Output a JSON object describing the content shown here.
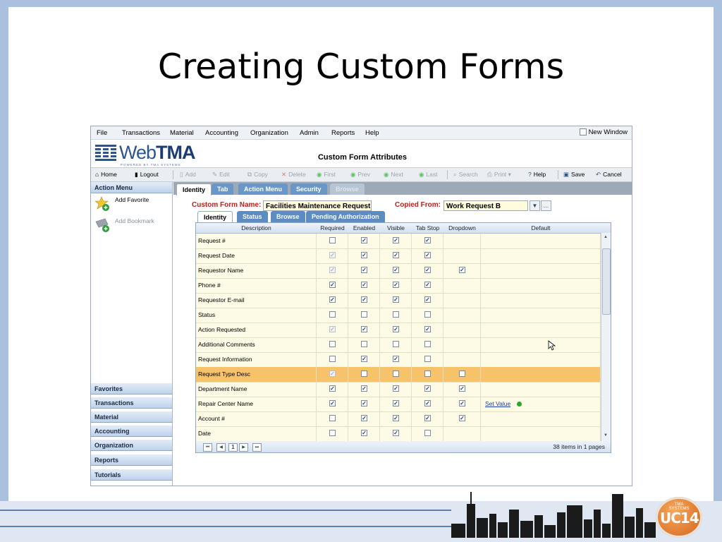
{
  "slide": {
    "title": "Creating Custom Forms",
    "badge": "UC14",
    "badge_small": "TMA SYSTEMS"
  },
  "menu": {
    "items": [
      "File",
      "Transactions",
      "Material",
      "Accounting",
      "Organization",
      "Admin",
      "Reports",
      "Help"
    ],
    "new_window": "New Window"
  },
  "logo": {
    "word_light": "Web",
    "word_bold": "TMA",
    "tagline": "POWERED BY TMA SYSTEMS"
  },
  "page_heading": "Custom Form Attributes",
  "toolbar": {
    "home": "Home",
    "logout": "Logout",
    "add": "Add",
    "edit": "Edit",
    "copy": "Copy",
    "delete": "Delete",
    "first": "First",
    "prev": "Prev",
    "next": "Next",
    "last": "Last",
    "search": "Search",
    "print": "Print",
    "help": "Help",
    "save": "Save",
    "cancel": "Cancel"
  },
  "sidebar": {
    "action_menu": "Action Menu",
    "add_favorite": "Add Favorite",
    "add_bookmark": "Add Bookmark",
    "sections": [
      "Favorites",
      "Transactions",
      "Material",
      "Accounting",
      "Organization",
      "Reports",
      "Tutorials"
    ]
  },
  "top_tabs": [
    "Identity",
    "Tab",
    "Action Menu",
    "Security",
    "Browse"
  ],
  "form": {
    "name_label": "Custom Form Name:",
    "name_value": "Facilities Maintenance Request",
    "copied_label": "Copied From:",
    "copied_value": "Work Request B"
  },
  "inner_tabs": [
    "Identity",
    "Status",
    "Browse",
    "Pending Authorization"
  ],
  "grid": {
    "columns": [
      "Description",
      "Required",
      "Enabled",
      "Visible",
      "Tab Stop",
      "Dropdown",
      "Default"
    ],
    "rows": [
      {
        "desc": "Request #",
        "req": 0,
        "ena": 1,
        "vis": 1,
        "tab": 1,
        "dd": null,
        "req_dim": false
      },
      {
        "desc": "Request Date",
        "req": 1,
        "ena": 1,
        "vis": 1,
        "tab": 1,
        "dd": null,
        "req_dim": true
      },
      {
        "desc": "Requestor Name",
        "req": 1,
        "ena": 1,
        "vis": 1,
        "tab": 1,
        "dd": 1,
        "req_dim": true
      },
      {
        "desc": "Phone #",
        "req": 1,
        "ena": 1,
        "vis": 1,
        "tab": 1,
        "dd": null,
        "req_dim": false
      },
      {
        "desc": "Requestor E-mail",
        "req": 1,
        "ena": 1,
        "vis": 1,
        "tab": 1,
        "dd": null,
        "req_dim": false
      },
      {
        "desc": "Status",
        "req": 0,
        "ena": 0,
        "vis": 0,
        "tab": 0,
        "dd": null,
        "req_dim": false
      },
      {
        "desc": "Action Requested",
        "req": 1,
        "ena": 1,
        "vis": 1,
        "tab": 1,
        "dd": null,
        "req_dim": true
      },
      {
        "desc": "Additional Comments",
        "req": 0,
        "ena": 0,
        "vis": 0,
        "tab": 0,
        "dd": null,
        "req_dim": false
      },
      {
        "desc": "Request Information",
        "req": 0,
        "ena": 1,
        "vis": 1,
        "tab": 0,
        "dd": null,
        "req_dim": false
      },
      {
        "desc": "Request Type Desc",
        "req": 1,
        "ena": 0,
        "vis": 0,
        "tab": 0,
        "dd": 0,
        "req_dim": true,
        "highlight": true
      },
      {
        "desc": "Department Name",
        "req": 1,
        "ena": 1,
        "vis": 1,
        "tab": 1,
        "dd": 1,
        "req_dim": false
      },
      {
        "desc": "Repair Center Name",
        "req": 1,
        "ena": 1,
        "vis": 1,
        "tab": 1,
        "dd": 1,
        "req_dim": false,
        "default": "Set Value"
      },
      {
        "desc": "Account #",
        "req": 0,
        "ena": 1,
        "vis": 1,
        "tab": 1,
        "dd": 1,
        "req_dim": false
      },
      {
        "desc": "Date",
        "req": 0,
        "ena": 1,
        "vis": 1,
        "tab": 0,
        "dd": null,
        "req_dim": false
      }
    ],
    "page_number": "1",
    "status": "38 items in 1 pages"
  },
  "colors": {
    "accent": "#6b97c8",
    "highlight": "#f7c36a",
    "label_red": "#b3241a"
  }
}
